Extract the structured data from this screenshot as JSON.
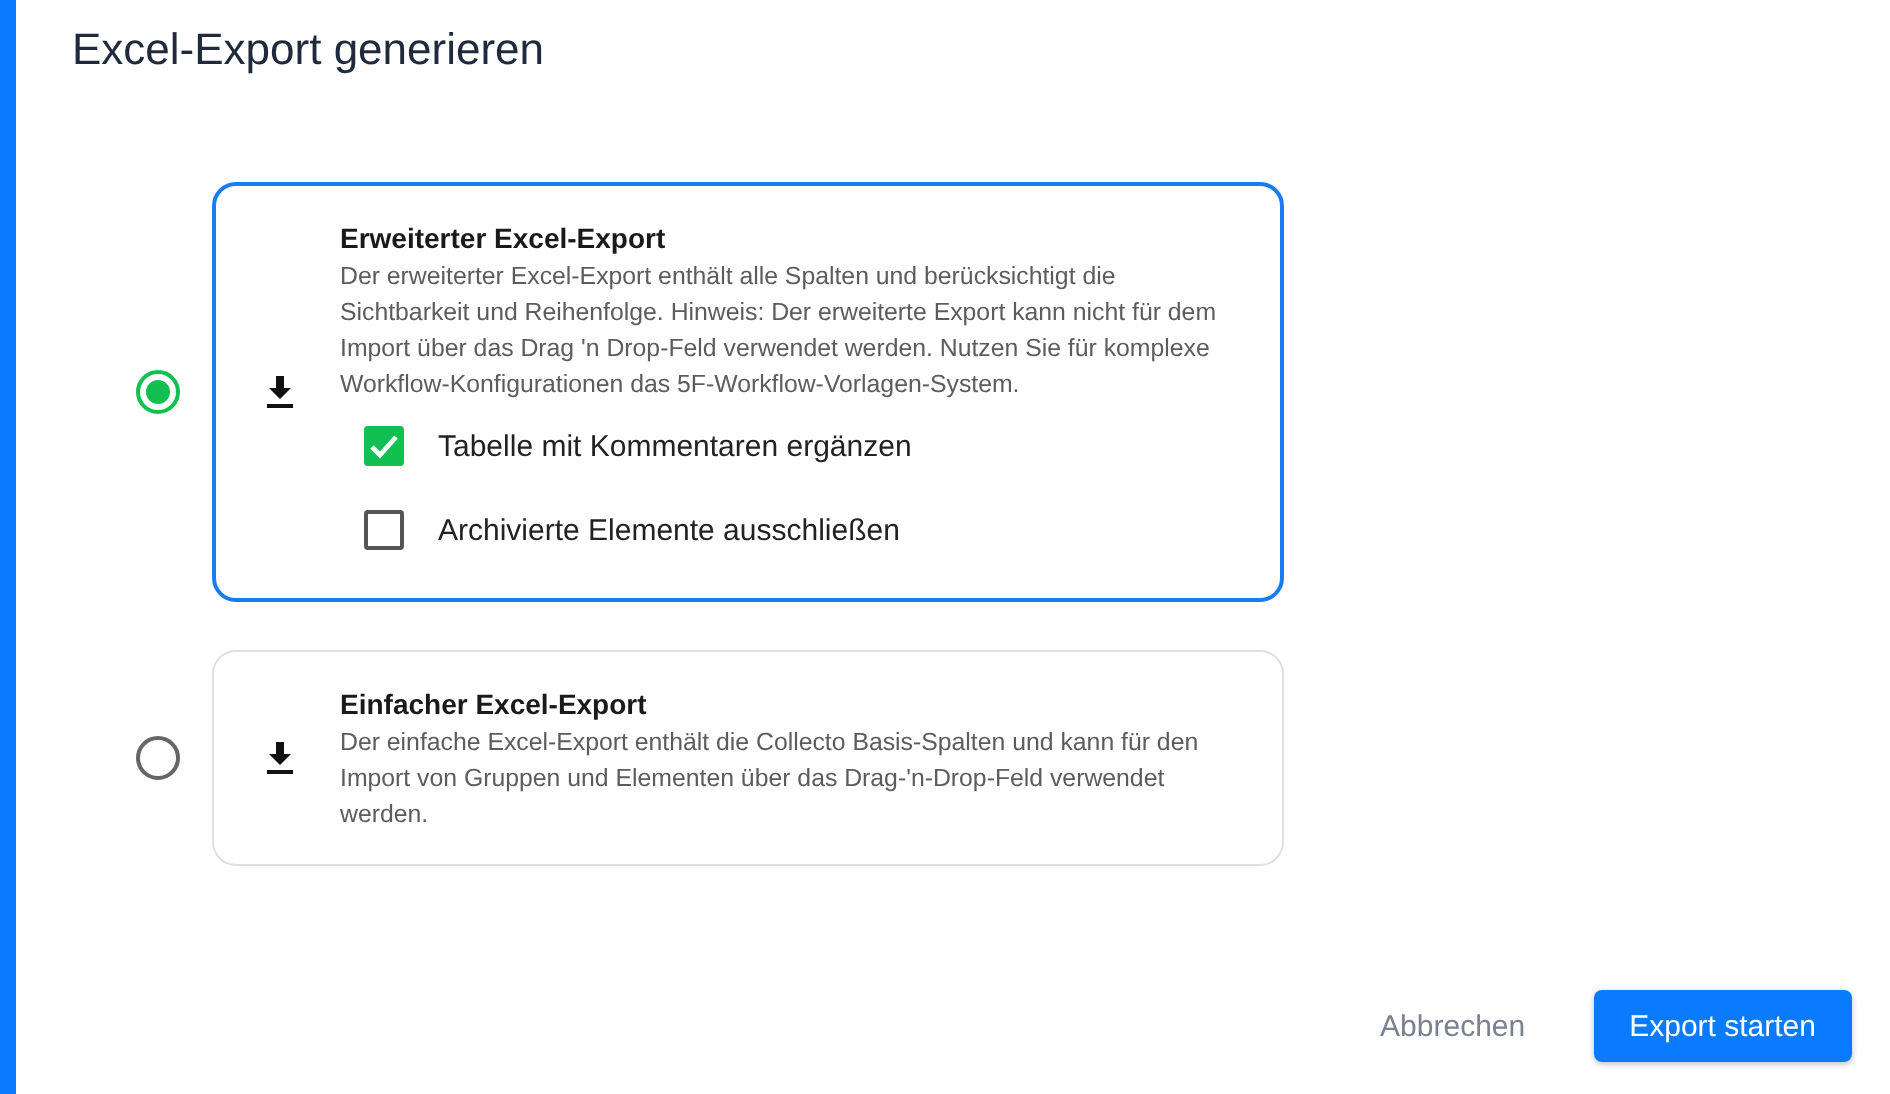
{
  "dialog": {
    "title": "Excel-Export generieren"
  },
  "options": [
    {
      "title": "Erweiterter Excel-Export",
      "description": "Der erweiterter Excel-Export enthält alle Spalten und berücksichtigt die Sichtbarkeit und Reihenfolge. Hinweis: Der erweiterte Export kann nicht für dem Import über das Drag 'n Drop-Feld verwendet werden. Nutzen Sie für komplexe Workflow-Konfigurationen das 5F-Workflow-Vorlagen-System.",
      "selected": true,
      "checkboxes": [
        {
          "label": "Tabelle mit Kommentaren ergänzen",
          "checked": true
        },
        {
          "label": "Archivierte Elemente ausschließen",
          "checked": false
        }
      ]
    },
    {
      "title": "Einfacher Excel-Export",
      "description": "Der einfache Excel-Export enthält die Collecto Basis-Spalten und kann für den Import von Gruppen und Elementen über das Drag-'n-Drop-Feld verwendet werden.",
      "selected": false
    }
  ],
  "buttons": [
    {
      "label": "Abbrechen",
      "kind": "text"
    },
    {
      "label": "Export starten",
      "kind": "primary"
    }
  ]
}
